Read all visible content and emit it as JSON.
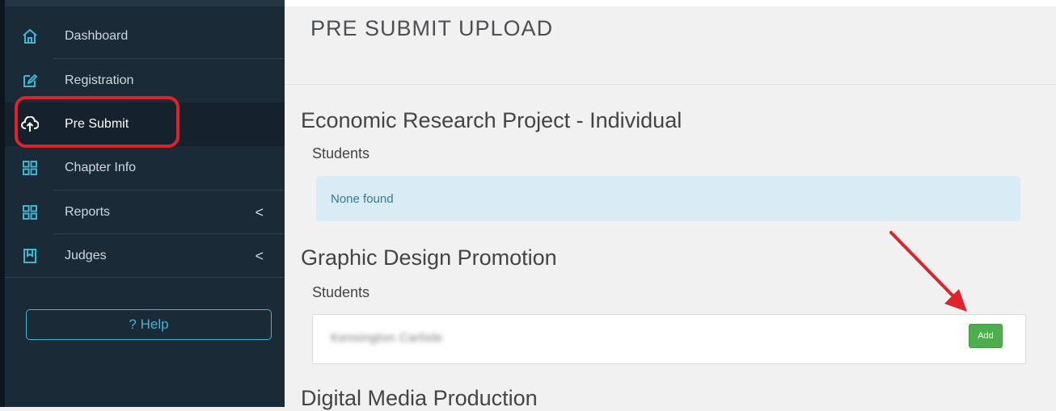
{
  "sidebar": {
    "items": [
      {
        "label": "Dashboard",
        "icon": "home-icon"
      },
      {
        "label": "Registration",
        "icon": "edit-icon"
      },
      {
        "label": "Pre Submit",
        "icon": "cloud-upload-icon"
      },
      {
        "label": "Chapter Info",
        "icon": "grid-icon"
      },
      {
        "label": "Reports",
        "icon": "grid-icon",
        "chevron": "<"
      },
      {
        "label": "Judges",
        "icon": "book-icon",
        "chevron": "<"
      }
    ],
    "help_label": "? Help"
  },
  "page": {
    "title": "PRE SUBMIT UPLOAD"
  },
  "sections": [
    {
      "title": "Economic Research Project - Individual",
      "students_label": "Students",
      "empty_text": "None found"
    },
    {
      "title": "Graphic Design Promotion",
      "students_label": "Students",
      "student_name": "Kensington Carlisle",
      "add_label": "Add"
    },
    {
      "title": "Digital Media Production"
    }
  ],
  "colors": {
    "sidebar_bg": "#1b2a37",
    "accent": "#3db7d6",
    "highlight": "#e0232a",
    "add_button": "#4cae4c"
  }
}
